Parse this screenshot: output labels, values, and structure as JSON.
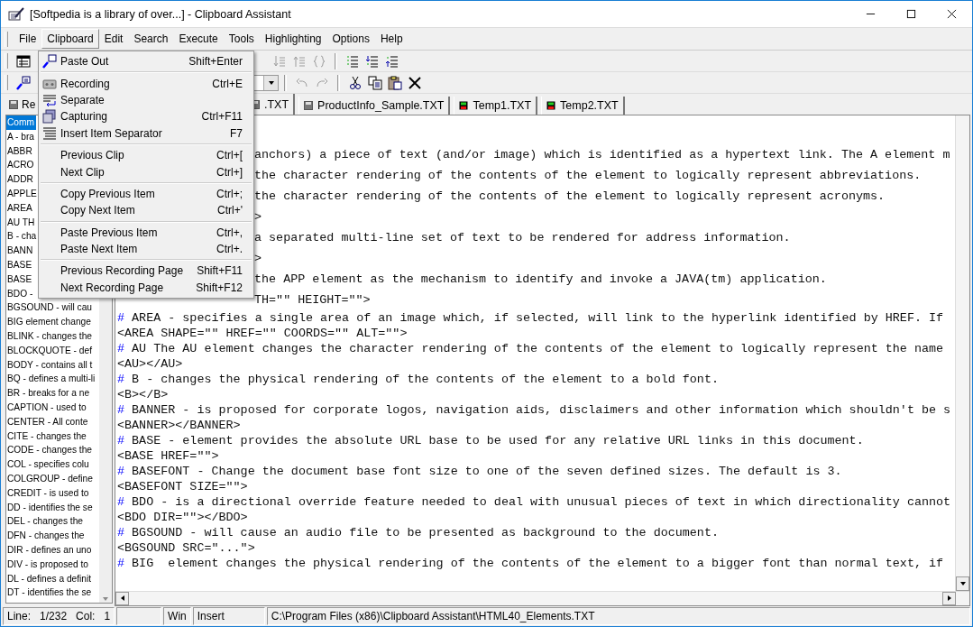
{
  "window": {
    "title": "[Softpedia is a library of over...] - Clipboard Assistant"
  },
  "menu_bar": [
    {
      "label": "File",
      "selected": false
    },
    {
      "label": "Clipboard",
      "selected": true
    },
    {
      "label": "Edit",
      "selected": false
    },
    {
      "label": "Search",
      "selected": false
    },
    {
      "label": "Execute",
      "selected": false
    },
    {
      "label": "Tools",
      "selected": false
    },
    {
      "label": "Highlighting",
      "selected": false
    },
    {
      "label": "Options",
      "selected": false
    },
    {
      "label": "Help",
      "selected": false
    }
  ],
  "clipboard_menu": [
    [
      {
        "label": "Paste Out",
        "shortcut": "Shift+Enter",
        "kind": "paste-out"
      }
    ],
    [
      {
        "label": "Recording",
        "shortcut": "Ctrl+E",
        "kind": "recording"
      },
      {
        "label": "Separate",
        "kind": "separate"
      },
      {
        "label": "Capturing",
        "shortcut": "Ctrl+F11",
        "kind": "capturing"
      },
      {
        "label": "Insert Item Separator",
        "shortcut": "F7",
        "kind": "separator"
      }
    ],
    [
      {
        "label": "Previous Clip",
        "shortcut": "Ctrl+["
      },
      {
        "label": "Next Clip",
        "shortcut": "Ctrl+]"
      }
    ],
    [
      {
        "label": "Copy Previous Item",
        "shortcut": "Ctrl+;"
      },
      {
        "label": "Copy Next Item",
        "shortcut": "Ctrl+'"
      }
    ],
    [
      {
        "label": "Paste Previous Item",
        "shortcut": "Ctrl+,"
      },
      {
        "label": "Paste Next Item",
        "shortcut": "Ctrl+."
      }
    ],
    [
      {
        "label": "Previous Recording Page",
        "shortcut": "Shift+F11"
      },
      {
        "label": "Next Recording Page",
        "shortcut": "Shift+F12"
      }
    ]
  ],
  "toolbar_1": {
    "left": [
      {
        "kind": "window",
        "disabled": false
      }
    ],
    "right": [
      {
        "kind": "sort-down",
        "disabled": true
      },
      {
        "kind": "sort-up",
        "disabled": true
      },
      {
        "kind": "braces",
        "disabled": true
      },
      {
        "kind": "list",
        "disabled": false
      },
      {
        "kind": "list-down",
        "disabled": false
      },
      {
        "kind": "list-up",
        "disabled": false
      }
    ]
  },
  "toolbar_2": {
    "left": [
      {
        "kind": "paste-out",
        "disabled": false
      }
    ],
    "right": [
      {
        "kind": "undo",
        "disabled": true
      },
      {
        "kind": "redo",
        "disabled": true
      },
      {
        "kind": "cut",
        "disabled": false
      },
      {
        "kind": "copy",
        "disabled": false
      },
      {
        "kind": "paste",
        "disabled": false
      },
      {
        "kind": "delete",
        "disabled": false
      }
    ]
  },
  "left_panel": {
    "title": "Re",
    "items": [
      {
        "label": "Comm",
        "selected": true
      },
      {
        "label": "A - bra",
        "selected": false
      },
      {
        "label": "ABBR",
        "selected": false
      },
      {
        "label": "ACRO",
        "selected": false
      },
      {
        "label": "ADDR",
        "selected": false
      },
      {
        "label": "APPLE",
        "selected": false
      },
      {
        "label": "AREA",
        "selected": false
      },
      {
        "label": "AU TH",
        "selected": false
      },
      {
        "label": "B - cha",
        "selected": false
      },
      {
        "label": "BANN",
        "selected": false
      },
      {
        "label": "BASE",
        "selected": false
      },
      {
        "label": "BASE",
        "selected": false
      },
      {
        "label": "BDO -",
        "selected": false
      },
      {
        "label": "BGSOUND - will cau",
        "selected": false
      },
      {
        "label": "BIG  element change",
        "selected": false
      },
      {
        "label": "BLINK - changes the",
        "selected": false
      },
      {
        "label": "BLOCKQUOTE - def",
        "selected": false
      },
      {
        "label": "BODY - contains all t",
        "selected": false
      },
      {
        "label": "BQ - defines a multi-li",
        "selected": false
      },
      {
        "label": "BR - breaks for a ne",
        "selected": false
      },
      {
        "label": "CAPTION - used to",
        "selected": false
      },
      {
        "label": "CENTER - All conte",
        "selected": false
      },
      {
        "label": "CITE - changes the",
        "selected": false
      },
      {
        "label": "CODE - changes the",
        "selected": false
      },
      {
        "label": "COL - specifies colu",
        "selected": false
      },
      {
        "label": "COLGROUP - define",
        "selected": false
      },
      {
        "label": "CREDIT - is used to",
        "selected": false
      },
      {
        "label": "DD - identifies the se",
        "selected": false
      },
      {
        "label": "DEL - changes the",
        "selected": false
      },
      {
        "label": "DFN - changes the",
        "selected": false
      },
      {
        "label": "DIR - defines an uno",
        "selected": false
      },
      {
        "label": "DIV - is proposed to",
        "selected": false
      },
      {
        "label": "DL - defines a definit",
        "selected": false
      },
      {
        "label": "DT - identifies the se",
        "selected": false
      }
    ]
  },
  "tabs": [
    {
      "label": ".TXT",
      "selected": true,
      "kind": "disk"
    },
    {
      "label": "ProductInfo_Sample.TXT",
      "selected": false,
      "kind": "disk"
    },
    {
      "label": "Temp1.TXT",
      "selected": false,
      "kind": "temp"
    },
    {
      "label": "Temp2.TXT",
      "selected": false,
      "kind": "temp"
    }
  ],
  "editor": {
    "lines": [
      {
        "kind": "clipped",
        "text": "anchors) a piece of text (and/or image) which is identified as a hypertext link. The A element m"
      },
      {
        "kind": "clipped",
        "text": "the character rendering of the contents of the element to logically represent abbreviations."
      },
      {
        "kind": "clipped",
        "text": "the character rendering of the contents of the element to logically represent acronyms."
      },
      {
        "kind": "clipped",
        "text": ">"
      },
      {
        "kind": "clipped",
        "text": "a separated multi-line set of text to be rendered for address information."
      },
      {
        "kind": "clipped",
        "text": ">"
      },
      {
        "kind": "clipped",
        "text": "the APP element as the mechanism to identify and invoke a JAVA(tm) application."
      },
      {
        "kind": "clipped",
        "text": "TH=\"\" HEIGHT=\"\">"
      },
      {
        "kind": "comment",
        "mark": "#",
        "text": " AREA - specifies a single area of an image which, if selected, will link to the hyperlink identified by HREF. If"
      },
      {
        "kind": "code",
        "text": "<AREA SHAPE=\"\" HREF=\"\" COORDS=\"\" ALT=\"\">"
      },
      {
        "kind": "comment",
        "mark": "#",
        "text": " AU The AU element changes the character rendering of the contents of the element to logically represent the name"
      },
      {
        "kind": "code",
        "text": "<AU></AU>"
      },
      {
        "kind": "comment",
        "mark": "#",
        "text": " B - changes the physical rendering of the contents of the element to a bold font."
      },
      {
        "kind": "code",
        "text": "<B></B>"
      },
      {
        "kind": "comment",
        "mark": "#",
        "text": " BANNER - is proposed for corporate logos, navigation aids, disclaimers and other information which shouldn't be s"
      },
      {
        "kind": "code",
        "text": "<BANNER></BANNER>"
      },
      {
        "kind": "comment",
        "mark": "#",
        "text": " BASE - element provides the absolute URL base to be used for any relative URL links in this document."
      },
      {
        "kind": "code",
        "text": "<BASE HREF=\"\">"
      },
      {
        "kind": "comment",
        "mark": "#",
        "text": " BASEFONT - Change the document base font size to one of the seven defined sizes. The default is 3."
      },
      {
        "kind": "code",
        "text": "<BASEFONT SIZE=\"\">"
      },
      {
        "kind": "comment",
        "mark": "#",
        "text": " BDO - is a directional override feature needed to deal with unusual pieces of text in which directionality cannot"
      },
      {
        "kind": "code",
        "text": "<BDO DIR=\"\"></BDO>"
      },
      {
        "kind": "comment",
        "mark": "#",
        "text": " BGSOUND - will cause an audio file to be presented as background to the document."
      },
      {
        "kind": "code",
        "text": "<BGSOUND SRC=\"...\">"
      },
      {
        "kind": "comment",
        "mark": "#",
        "text": " BIG  element changes the physical rendering of the contents of the element to a bigger font than normal text, if"
      }
    ]
  },
  "status_bar": {
    "position": "Line:   1/232   Col:   1",
    "mode": "Win",
    "insert_mode": "Insert",
    "path": "C:\\Program Files (x86)\\Clipboard Assistant\\HTML40_Elements.TXT"
  }
}
